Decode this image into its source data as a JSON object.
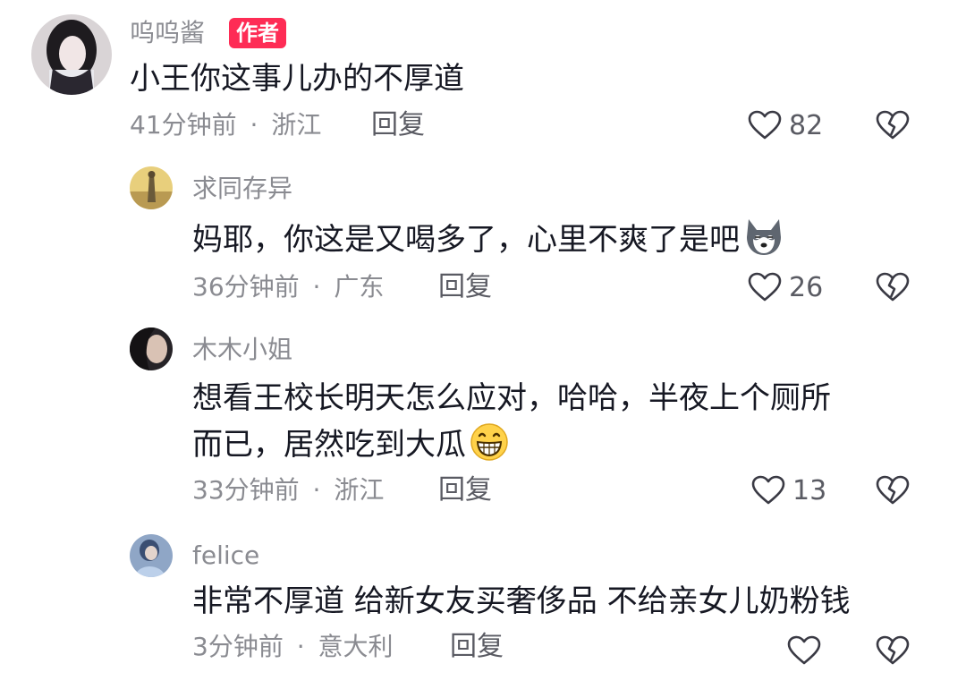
{
  "comments": [
    {
      "user": "呜呜酱",
      "badge": "作者",
      "text": "小王你这事儿办的不厚道",
      "time": "41分钟前",
      "location": "浙江",
      "reply_label": "回复",
      "likes": "82"
    },
    {
      "user": "求同存异",
      "text": "妈耶，你这是又喝多了，心里不爽了是吧",
      "emoji": "husky-emoji",
      "time": "36分钟前",
      "location": "广东",
      "reply_label": "回复",
      "likes": "26"
    },
    {
      "user": "木木小姐",
      "text_line1": "想看王校长明天怎么应对，哈哈，半夜上个厕所",
      "text_line2": "而已，居然吃到大瓜",
      "emoji": "grin-emoji",
      "time": "33分钟前",
      "location": "浙江",
      "reply_label": "回复",
      "likes": "13"
    },
    {
      "user": "felice",
      "text": "非常不厚道 给新女友买奢侈品 不给亲女儿奶粉钱",
      "time": "3分钟前",
      "location": "意大利",
      "reply_label": "回复"
    }
  ],
  "meta_separator": "·",
  "icons": {
    "like": "heart-outline-icon",
    "dislike": "broken-heart-icon"
  },
  "colors": {
    "badge": "#fe2c55",
    "secondary_text": "#8a8b91",
    "primary_text": "#161823"
  }
}
